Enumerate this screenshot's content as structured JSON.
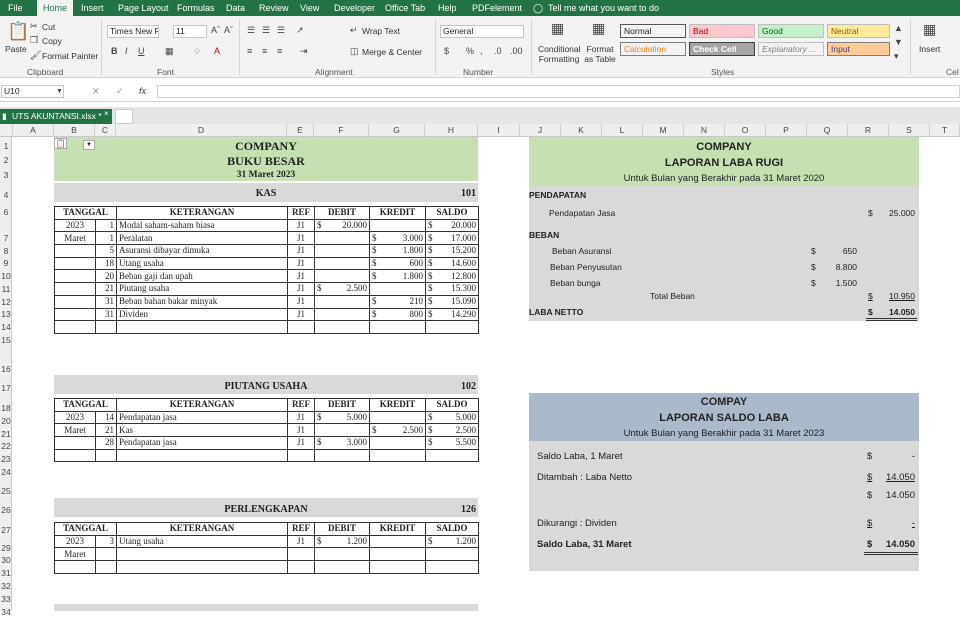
{
  "ribbon_tabs": [
    "File",
    "Home",
    "Insert",
    "Page Layout",
    "Formulas",
    "Data",
    "Review",
    "View",
    "Developer",
    "Office Tab",
    "Help",
    "PDFelement"
  ],
  "tell_me": "Tell me what you want to do",
  "clipboard": {
    "cut": "Cut",
    "copy": "Copy",
    "paste": "Paste",
    "format_painter": "Format Painter",
    "label": "Clipboard"
  },
  "font": {
    "name": "Times New Ro",
    "size": "11",
    "label": "Font"
  },
  "alignment": {
    "wrap": "Wrap Text",
    "merge": "Merge & Center",
    "label": "Alignment"
  },
  "number": {
    "format": "General",
    "label": "Number"
  },
  "styles": {
    "cond": "Conditional Formatting",
    "table": "Format as Table",
    "label": "Styles",
    "cells": [
      {
        "t": "Normal",
        "bg": "#ffffff",
        "fg": "#000000"
      },
      {
        "t": "Bad",
        "bg": "#ffc7ce",
        "fg": "#9c0006"
      },
      {
        "t": "Good",
        "bg": "#c6efce",
        "fg": "#006100"
      },
      {
        "t": "Neutral",
        "bg": "#ffeb9c",
        "fg": "#9c5700"
      },
      {
        "t": "Calculation",
        "bg": "#f2f2f2",
        "fg": "#fa7d00"
      },
      {
        "t": "Check Cell",
        "bg": "#a5a5a5",
        "fg": "#ffffff"
      },
      {
        "t": "Explanatory ...",
        "bg": "#ffffff",
        "fg": "#7f7f7f"
      },
      {
        "t": "Input",
        "bg": "#ffcc99",
        "fg": "#3f3f76"
      }
    ]
  },
  "cells_group": {
    "insert": "Insert",
    "label": "Cel"
  },
  "name_box": "U10",
  "fx": "fx",
  "file_tab": "UTS AKUNTANSI.xlsx *",
  "columns": [
    "A",
    "B",
    "C",
    "D",
    "E",
    "F",
    "G",
    "H",
    "I",
    "J",
    "K",
    "L",
    "M",
    "N",
    "O",
    "P",
    "Q",
    "R",
    "S",
    "T"
  ],
  "rows": [
    "1",
    "2",
    "3",
    "4",
    "6",
    "7",
    "8",
    "9",
    "10",
    "11",
    "12",
    "13",
    "14",
    "15",
    "16",
    "17",
    "18",
    "20",
    "21",
    "22",
    "23",
    "24",
    "25",
    "26",
    "27",
    "29",
    "30",
    "31",
    "32",
    "33",
    "34"
  ],
  "ledger": {
    "company": "COMPANY",
    "title": "BUKU BESAR",
    "date": "31 Maret 2023",
    "headers": [
      "TANGGAL",
      "KETERANGAN",
      "REF",
      "DEBIT",
      "KREDIT",
      "SALDO"
    ],
    "kas": {
      "name": "KAS",
      "no": "101",
      "rows": [
        [
          "2023",
          "1",
          "Modal saham-saham biasa",
          "J1",
          "$",
          "20.000",
          "",
          "",
          "$",
          "20.000"
        ],
        [
          "Maret",
          "1",
          "Peralatan",
          "J1",
          "",
          "",
          "$",
          "3.000",
          "$",
          "17.000"
        ],
        [
          "",
          "5",
          "Asuransi dibayar dimuka",
          "J1",
          "",
          "",
          "$",
          "1.800",
          "$",
          "15.200"
        ],
        [
          "",
          "18",
          "Utang usaha",
          "J1",
          "",
          "",
          "$",
          "600",
          "$",
          "14.600"
        ],
        [
          "",
          "20",
          "Beban gaji dan upah",
          "J1",
          "",
          "",
          "$",
          "1.800",
          "$",
          "12.800"
        ],
        [
          "",
          "21",
          "Piutang usaha",
          "J1",
          "$",
          "2.500",
          "",
          "",
          "$",
          "15.300"
        ],
        [
          "",
          "31",
          "Beban bahan bakar minyak",
          "J1",
          "",
          "",
          "$",
          "210",
          "$",
          "15.090"
        ],
        [
          "",
          "31",
          "Dividen",
          "J1",
          "",
          "",
          "$",
          "800",
          "$",
          "14.290"
        ],
        [
          "",
          "",
          "",
          "",
          "",
          "",
          "",
          "",
          "",
          ""
        ]
      ]
    },
    "piutang": {
      "name": "PIUTANG USAHA",
      "no": "102",
      "rows": [
        [
          "2023",
          "14",
          "Pendapatan jasa",
          "J1",
          "$",
          "5.000",
          "",
          "",
          "$",
          "5.000"
        ],
        [
          "Maret",
          "21",
          "Kas",
          "J1",
          "",
          "",
          "$",
          "2.500",
          "$",
          "2.500"
        ],
        [
          "",
          "28",
          "Pendapatan jasa",
          "J1",
          "$",
          "3.000",
          "",
          "",
          "$",
          "5.500"
        ],
        [
          "",
          "",
          "",
          "",
          "",
          "",
          "",
          "",
          "",
          ""
        ]
      ]
    },
    "perlengkapan": {
      "name": "PERLENGKAPAN",
      "no": "126",
      "rows": [
        [
          "2023",
          "3",
          "Utang usaha",
          "J1",
          "$",
          "1.200",
          "",
          "",
          "$",
          "1.200"
        ],
        [
          "Maret",
          "",
          "",
          "",
          "",
          "",
          "",
          "",
          "",
          ""
        ],
        [
          "",
          "",
          "",
          "",
          "",
          "",
          "",
          "",
          "",
          ""
        ]
      ]
    }
  },
  "laba_rugi": {
    "company": "COMPANY",
    "title": "LAPORAN LABA RUGI",
    "period": "Untuk Bulan yang Berakhir pada 31 Maret 2020",
    "pendapatan": "PENDAPATAN",
    "pend_jasa": "Pendapatan Jasa",
    "pend_val": "25.000",
    "beban": "BEBAN",
    "items": [
      {
        "l": "Beban Asuransi",
        "v": "650"
      },
      {
        "l": "Beban Penyusutan",
        "v": "8.800"
      },
      {
        "l": "Beban bunga",
        "v": "1.500"
      }
    ],
    "total": "Total Beban",
    "total_val": "10.950",
    "netto": "LABA NETTO",
    "netto_val": "14.050",
    "cur": "$"
  },
  "saldo_laba": {
    "company": "COMPAY",
    "title": "LAPORAN SALDO LABA",
    "period": "Untuk Bulan yang Berakhir pada 31 Maret 2023",
    "rows": [
      {
        "l": "Saldo Laba,  1 Maret",
        "v": "-"
      },
      {
        "l": "Ditambah : Laba Netto",
        "v": "14.050"
      },
      {
        "l": "",
        "v": "14.050"
      },
      {
        "l": "Dikurangi : Dividen",
        "v": "-"
      },
      {
        "l": "Saldo Laba,  31 Maret",
        "v": "14.050"
      }
    ],
    "cur": "$"
  }
}
